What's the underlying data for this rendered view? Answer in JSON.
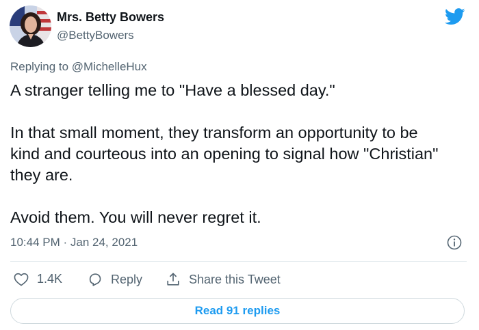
{
  "author": {
    "name": "Mrs. Betty Bowers",
    "handle": "@BettyBowers"
  },
  "reply_context": {
    "prefix": "Replying to ",
    "mention": "@MichelleHux"
  },
  "tweet": {
    "paragraphs": [
      "A stranger telling me to \"Have a blessed day.\"",
      "In that small moment, they transform an opportunity to be kind and courteous into an opening to signal how \"Christian\" they are.",
      "Avoid them. You will never regret it."
    ],
    "timestamp": "10:44 PM · Jan 24, 2021"
  },
  "actions": {
    "like_count": "1.4K",
    "reply_label": "Reply",
    "share_label": "Share this Tweet"
  },
  "read_replies_label": "Read 91 replies",
  "colors": {
    "twitter_blue": "#1d9bf0",
    "secondary_text": "#536471",
    "primary_text": "#0f1419",
    "divider": "#e1e8ed"
  },
  "icons": [
    "twitter-bird-icon",
    "info-icon",
    "heart-icon",
    "reply-bubble-icon",
    "share-icon"
  ]
}
